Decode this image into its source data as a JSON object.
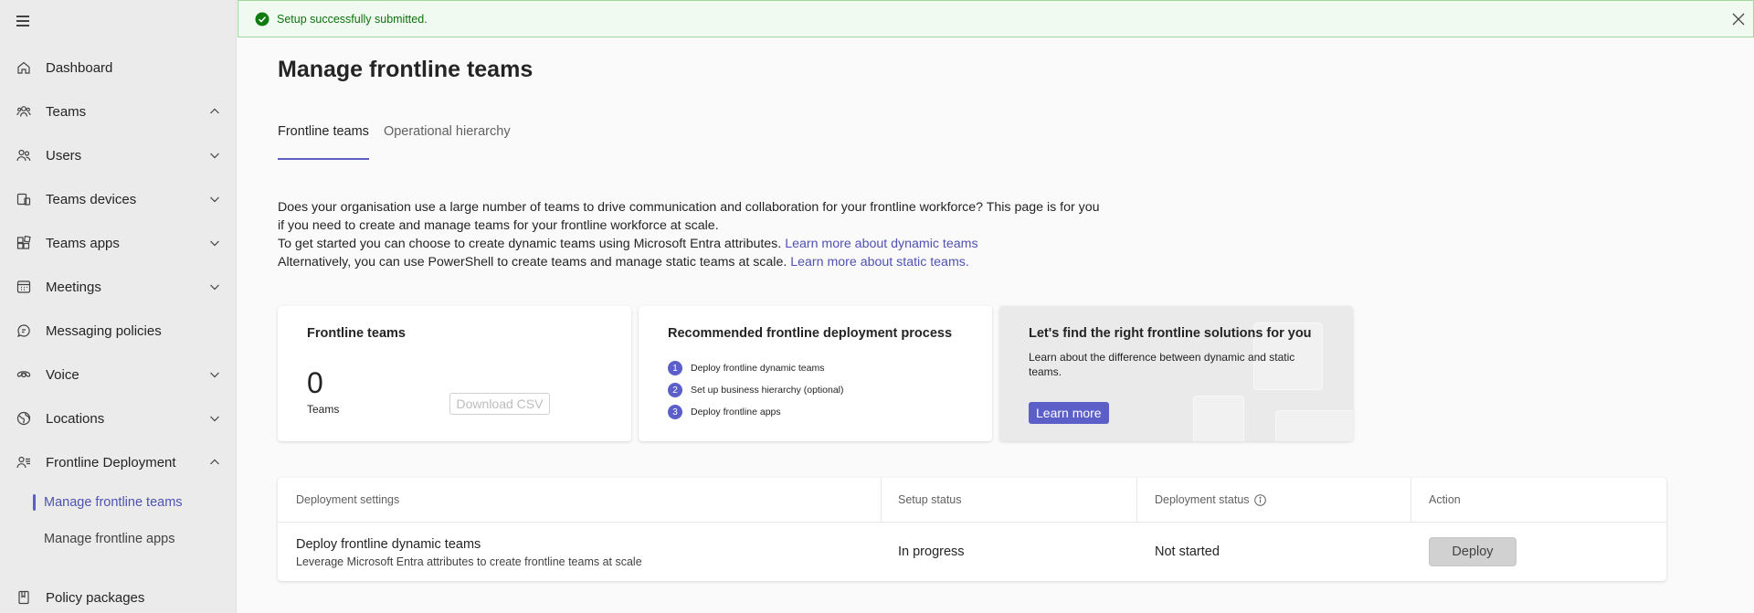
{
  "sidebar": {
    "items": [
      {
        "label": "Dashboard",
        "icon": "home-icon"
      },
      {
        "label": "Teams",
        "icon": "teams-icon",
        "expanded": true
      },
      {
        "label": "Users",
        "icon": "users-icon",
        "expanded": false
      },
      {
        "label": "Teams devices",
        "icon": "device-icon",
        "expanded": false
      },
      {
        "label": "Teams apps",
        "icon": "apps-icon",
        "expanded": false
      },
      {
        "label": "Meetings",
        "icon": "calendar-icon",
        "expanded": false
      },
      {
        "label": "Messaging policies",
        "icon": "chat-icon"
      },
      {
        "label": "Voice",
        "icon": "voice-icon",
        "expanded": false
      },
      {
        "label": "Locations",
        "icon": "globe-icon",
        "expanded": false
      },
      {
        "label": "Frontline Deployment",
        "icon": "people-icon",
        "expanded": true
      }
    ],
    "subitems": [
      {
        "label": "Manage frontline teams",
        "active": true
      },
      {
        "label": "Manage frontline apps",
        "active": false
      }
    ],
    "last_item": {
      "label": "Policy packages",
      "icon": "package-icon"
    }
  },
  "banner": {
    "message": "Setup successfully submitted."
  },
  "page": {
    "title": "Manage frontline teams"
  },
  "tabs": [
    {
      "label": "Frontline teams",
      "active": true
    },
    {
      "label": "Operational hierarchy",
      "active": false
    }
  ],
  "intro": {
    "line1": "Does your organisation use a large number of teams to drive communication and collaboration for your frontline workforce? This page is for you",
    "line2": "if you need to create and manage teams for your frontline workforce at scale.",
    "line3": "To get started you can choose to create dynamic teams using Microsoft Entra attributes.",
    "link1": "Learn more about dynamic teams",
    "line4": "Alternatively, you can use PowerShell to create teams and manage static teams at scale.",
    "link2": "Learn more about static teams."
  },
  "card_teams": {
    "title": "Frontline teams",
    "count": "0",
    "count_label": "Teams",
    "button": "Download CSV"
  },
  "card_process": {
    "title": "Recommended frontline deployment process",
    "steps": [
      {
        "num": "1",
        "label": "Deploy frontline dynamic teams"
      },
      {
        "num": "2",
        "label": "Set up business hierarchy (optional)"
      },
      {
        "num": "3",
        "label": "Deploy frontline apps"
      }
    ]
  },
  "card_solutions": {
    "title": "Let's find the right frontline solutions for you",
    "description": "Learn about the difference between dynamic and static teams.",
    "button": "Learn more"
  },
  "table": {
    "headers": [
      "Deployment settings",
      "Setup status",
      "Deployment status",
      "Action"
    ],
    "row": {
      "title": "Deploy frontline dynamic teams",
      "subtitle": "Leverage Microsoft Entra attributes to create frontline teams at scale",
      "setup_status": "In progress",
      "deployment_status": "Not started",
      "action": "Deploy"
    }
  },
  "colors": {
    "accent": "#5b5fc7",
    "link": "#4f52b2",
    "success_bg": "#f1faf1",
    "success_text": "#0e700e"
  }
}
